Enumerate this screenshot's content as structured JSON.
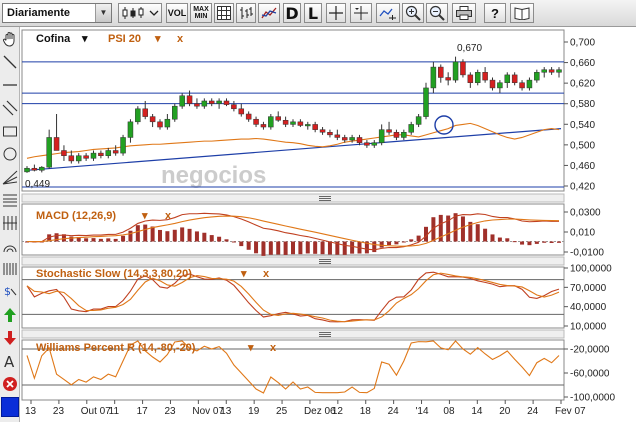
{
  "toolbar": {
    "period_select": "Diariamente",
    "vol_label": "VOL",
    "maxmin_label_top": "MAX",
    "maxmin_label_bottom": "MIN",
    "d_label": "D",
    "l_label": "L",
    "help_label": "?"
  },
  "colors": {
    "bull": "#22a022",
    "bear": "#d42020",
    "line": "#e07818",
    "support": "#1e3fa8",
    "macd_hist": "#a0302a",
    "title": "#c06010"
  },
  "main_panel": {
    "symbol": "Cofina",
    "indicator": "PSI 20",
    "watermark": "negocios",
    "max_label": "0,670",
    "min_label": "0,449",
    "y_ticks": [
      "0,700",
      "0,660",
      "0,620",
      "0,580",
      "0,540",
      "0,500",
      "0,460",
      "0,420"
    ]
  },
  "macd_panel": {
    "title": "MACD (12,26,9)",
    "y_ticks": [
      "0,0300",
      "0,010",
      "-0,0100"
    ]
  },
  "stoch_panel": {
    "title": "Stochastic Slow (14,3,3,80,20)",
    "y_ticks": [
      "100,0000",
      "70,0000",
      "40,0000",
      "10,0000"
    ]
  },
  "williams_panel": {
    "title": "Williams Percent R (14,-80,-20)",
    "y_ticks": [
      "-20,0000",
      "-60,0000",
      "-100,0000"
    ]
  },
  "x_labels": [
    "13",
    "23",
    "Out 07",
    "11",
    "17",
    "23",
    "Nov 07",
    "13",
    "19",
    "25",
    "Dez 06",
    "12",
    "18",
    "24",
    "'14",
    "08",
    "14",
    "20",
    "24",
    "Fev 07"
  ],
  "chart_data": {
    "type": "candlestick",
    "price_ylim": [
      0.42,
      0.7
    ],
    "candles": [
      [
        0.449,
        0.46,
        0.447,
        0.456
      ],
      [
        0.456,
        0.463,
        0.45,
        0.452
      ],
      [
        0.452,
        0.46,
        0.448,
        0.458
      ],
      [
        0.458,
        0.53,
        0.455,
        0.515
      ],
      [
        0.515,
        0.56,
        0.5,
        0.49
      ],
      [
        0.49,
        0.5,
        0.47,
        0.48
      ],
      [
        0.48,
        0.49,
        0.465,
        0.47
      ],
      [
        0.47,
        0.485,
        0.465,
        0.48
      ],
      [
        0.48,
        0.485,
        0.47,
        0.475
      ],
      [
        0.475,
        0.49,
        0.47,
        0.485
      ],
      [
        0.485,
        0.49,
        0.475,
        0.48
      ],
      [
        0.48,
        0.495,
        0.475,
        0.49
      ],
      [
        0.49,
        0.5,
        0.48,
        0.485
      ],
      [
        0.485,
        0.52,
        0.48,
        0.515
      ],
      [
        0.515,
        0.55,
        0.505,
        0.545
      ],
      [
        0.545,
        0.575,
        0.54,
        0.57
      ],
      [
        0.57,
        0.585,
        0.55,
        0.555
      ],
      [
        0.555,
        0.56,
        0.535,
        0.545
      ],
      [
        0.545,
        0.55,
        0.53,
        0.535
      ],
      [
        0.535,
        0.56,
        0.53,
        0.55
      ],
      [
        0.55,
        0.58,
        0.545,
        0.575
      ],
      [
        0.575,
        0.6,
        0.57,
        0.595
      ],
      [
        0.595,
        0.605,
        0.575,
        0.58
      ],
      [
        0.58,
        0.59,
        0.57,
        0.575
      ],
      [
        0.575,
        0.59,
        0.57,
        0.585
      ],
      [
        0.585,
        0.59,
        0.575,
        0.58
      ],
      [
        0.58,
        0.59,
        0.57,
        0.585
      ],
      [
        0.585,
        0.59,
        0.575,
        0.578
      ],
      [
        0.578,
        0.585,
        0.565,
        0.57
      ],
      [
        0.57,
        0.58,
        0.555,
        0.56
      ],
      [
        0.56,
        0.565,
        0.545,
        0.55
      ],
      [
        0.55,
        0.555,
        0.535,
        0.54
      ],
      [
        0.54,
        0.545,
        0.53,
        0.535
      ],
      [
        0.535,
        0.56,
        0.53,
        0.555
      ],
      [
        0.555,
        0.565,
        0.545,
        0.548
      ],
      [
        0.548,
        0.555,
        0.535,
        0.54
      ],
      [
        0.54,
        0.55,
        0.535,
        0.545
      ],
      [
        0.545,
        0.55,
        0.535,
        0.538
      ],
      [
        0.538,
        0.545,
        0.53,
        0.54
      ],
      [
        0.54,
        0.545,
        0.525,
        0.53
      ],
      [
        0.53,
        0.535,
        0.52,
        0.525
      ],
      [
        0.525,
        0.53,
        0.515,
        0.52
      ],
      [
        0.52,
        0.53,
        0.51,
        0.515
      ],
      [
        0.515,
        0.52,
        0.505,
        0.51
      ],
      [
        0.51,
        0.52,
        0.505,
        0.515
      ],
      [
        0.515,
        0.52,
        0.5,
        0.505
      ],
      [
        0.505,
        0.51,
        0.495,
        0.5
      ],
      [
        0.5,
        0.51,
        0.495,
        0.505
      ],
      [
        0.505,
        0.54,
        0.5,
        0.53
      ],
      [
        0.53,
        0.545,
        0.52,
        0.525
      ],
      [
        0.525,
        0.53,
        0.51,
        0.515
      ],
      [
        0.515,
        0.53,
        0.51,
        0.525
      ],
      [
        0.525,
        0.545,
        0.52,
        0.54
      ],
      [
        0.54,
        0.56,
        0.535,
        0.555
      ],
      [
        0.555,
        0.62,
        0.55,
        0.61
      ],
      [
        0.61,
        0.66,
        0.6,
        0.65
      ],
      [
        0.65,
        0.655,
        0.62,
        0.63
      ],
      [
        0.63,
        0.64,
        0.615,
        0.625
      ],
      [
        0.625,
        0.67,
        0.62,
        0.66
      ],
      [
        0.66,
        0.665,
        0.63,
        0.635
      ],
      [
        0.635,
        0.64,
        0.61,
        0.62
      ],
      [
        0.62,
        0.645,
        0.615,
        0.64
      ],
      [
        0.64,
        0.65,
        0.62,
        0.625
      ],
      [
        0.625,
        0.63,
        0.605,
        0.61
      ],
      [
        0.61,
        0.625,
        0.6,
        0.62
      ],
      [
        0.62,
        0.64,
        0.61,
        0.635
      ],
      [
        0.635,
        0.64,
        0.615,
        0.62
      ],
      [
        0.62,
        0.625,
        0.605,
        0.61
      ],
      [
        0.61,
        0.63,
        0.605,
        0.625
      ],
      [
        0.625,
        0.645,
        0.62,
        0.64
      ],
      [
        0.64,
        0.65,
        0.63,
        0.645
      ],
      [
        0.645,
        0.65,
        0.635,
        0.64
      ],
      [
        0.64,
        0.65,
        0.63,
        0.645
      ]
    ],
    "psi20_overlay": [
      0.475,
      0.478,
      0.48,
      0.482,
      0.484,
      0.486,
      0.487,
      0.488,
      0.49,
      0.492,
      0.493,
      0.494,
      0.495,
      0.497,
      0.499,
      0.5,
      0.501,
      0.502,
      0.502,
      0.503,
      0.504,
      0.505,
      0.506,
      0.507,
      0.508,
      0.508,
      0.509,
      0.51,
      0.511,
      0.512,
      0.512,
      0.513,
      0.512,
      0.51,
      0.508,
      0.506,
      0.505,
      0.503,
      0.5,
      0.498,
      0.497,
      0.499,
      0.502,
      0.506,
      0.508,
      0.51,
      0.512,
      0.514,
      0.516,
      0.518,
      0.52,
      0.52,
      0.518,
      0.516,
      0.52,
      0.524,
      0.528,
      0.532,
      0.538,
      0.54,
      0.542,
      0.538,
      0.532,
      0.526,
      0.52,
      0.515,
      0.512,
      0.515,
      0.52,
      0.525,
      0.53,
      0.532,
      0.53
    ]
  }
}
